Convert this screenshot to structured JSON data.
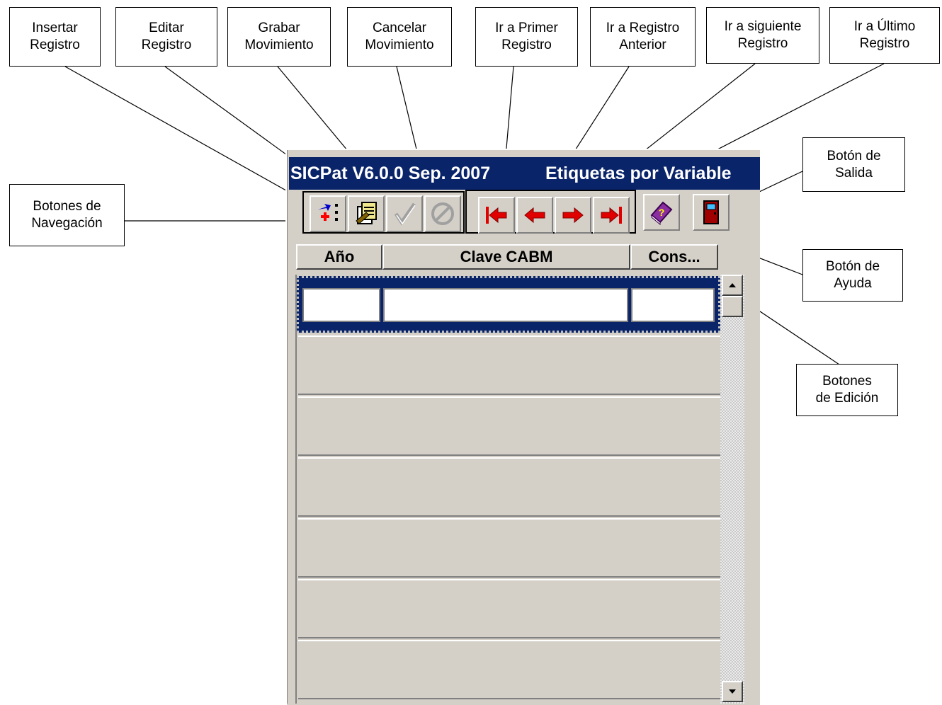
{
  "window": {
    "title_left": "SICPat V6.0.0 Sep. 2007",
    "title_right": "Etiquetas por Variable"
  },
  "callouts": {
    "insertar_registro": [
      "Insertar",
      "Registro"
    ],
    "editar_registro": [
      "Editar",
      "Registro"
    ],
    "grabar_movimiento": [
      "Grabar",
      "Movimiento"
    ],
    "cancelar_movimiento": [
      "Cancelar",
      "Movimiento"
    ],
    "ir_primer_registro": [
      "Ir a Primer",
      "Registro"
    ],
    "ir_registro_anterior": [
      "Ir a Registro",
      "Anterior"
    ],
    "ir_siguiente_registro": [
      "Ir a siguiente",
      "Registro"
    ],
    "ir_ultimo_registro": [
      "Ir a Último",
      "Registro"
    ],
    "boton_salida": [
      "Botón de",
      "Salida"
    ],
    "botones_navegacion": [
      "Botones de",
      "Navegación"
    ],
    "boton_ayuda": [
      "Botón de",
      "Ayuda"
    ],
    "botones_edicion": [
      "Botones",
      "de Edición"
    ]
  },
  "toolbar": {
    "edit_buttons": [
      {
        "name": "insert-record-button",
        "icon": "insert-record-icon"
      },
      {
        "name": "edit-record-button",
        "icon": "edit-record-icon"
      },
      {
        "name": "save-movement-button",
        "icon": "checkmark-icon"
      },
      {
        "name": "cancel-movement-button",
        "icon": "cancel-circle-icon"
      }
    ],
    "nav_buttons": [
      {
        "name": "first-record-button",
        "icon": "arrow-first-icon"
      },
      {
        "name": "previous-record-button",
        "icon": "arrow-left-icon"
      },
      {
        "name": "next-record-button",
        "icon": "arrow-right-icon"
      },
      {
        "name": "last-record-button",
        "icon": "arrow-last-icon"
      }
    ],
    "help_button": {
      "icon": "help-book-icon"
    },
    "exit_button": {
      "icon": "exit-door-icon"
    }
  },
  "grid": {
    "columns": [
      "Año",
      "Clave CABM",
      "Cons..."
    ],
    "selected_row": [
      "",
      "",
      ""
    ]
  },
  "colors": {
    "titlebar": "#0a246a",
    "face": "#d4d0c8",
    "arrow": "#e00000"
  }
}
